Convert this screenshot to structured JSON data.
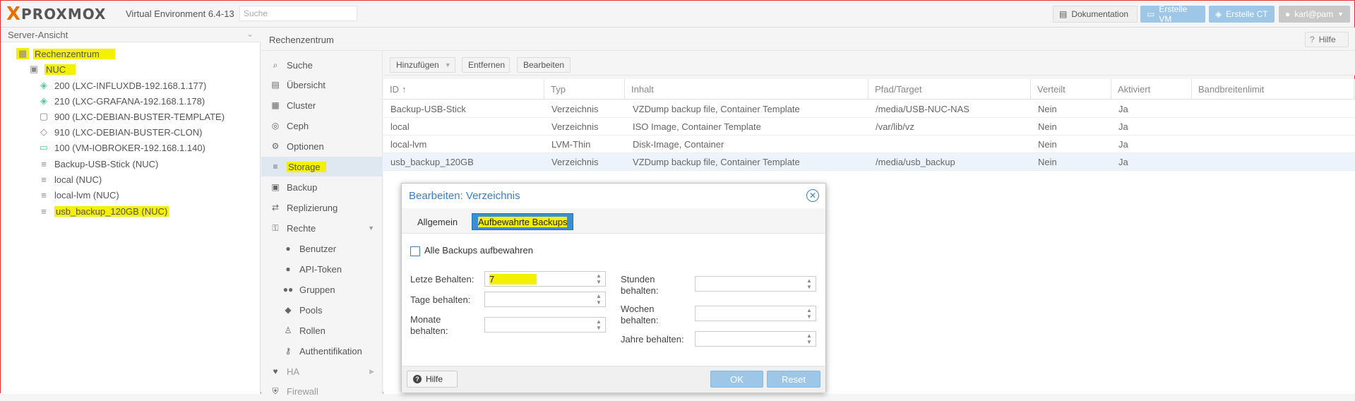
{
  "header": {
    "logo_x": "X",
    "logo_name": "PROXMOX",
    "version": "Virtual Environment 6.4-13",
    "search_placeholder": "Suche",
    "doc_label": "Dokumentation",
    "create_vm_label": "Erstelle VM",
    "create_ct_label": "Erstelle CT",
    "user_label": "karl@pam"
  },
  "left": {
    "view_label": "Server-Ansicht",
    "tree": [
      {
        "label": "Rechenzentrum"
      },
      {
        "label": "NUC"
      },
      {
        "label": "200 (LXC-INFLUXDB-192.168.1.177)"
      },
      {
        "label": "210 (LXC-GRAFANA-192.168.1.178)"
      },
      {
        "label": "900 (LXC-DEBIAN-BUSTER-TEMPLATE)"
      },
      {
        "label": "910 (LXC-DEBIAN-BUSTER-CLON)"
      },
      {
        "label": "100 (VM-IOBROKER-192.168.1.140)"
      },
      {
        "label": "Backup-USB-Stick (NUC)"
      },
      {
        "label": "local (NUC)"
      },
      {
        "label": "local-lvm (NUC)"
      },
      {
        "label": "usb_backup_120GB (NUC)"
      }
    ]
  },
  "main": {
    "title": "Rechenzentrum",
    "help_label": "Hilfe",
    "nav": [
      {
        "label": "Suche"
      },
      {
        "label": "Übersicht"
      },
      {
        "label": "Cluster"
      },
      {
        "label": "Ceph"
      },
      {
        "label": "Optionen"
      },
      {
        "label": "Storage"
      },
      {
        "label": "Backup"
      },
      {
        "label": "Replizierung"
      },
      {
        "label": "Rechte"
      },
      {
        "label": "Benutzer"
      },
      {
        "label": "API-Token"
      },
      {
        "label": "Gruppen"
      },
      {
        "label": "Pools"
      },
      {
        "label": "Rollen"
      },
      {
        "label": "Authentifikation"
      },
      {
        "label": "HA"
      },
      {
        "label": "Firewall"
      }
    ],
    "toolbar": {
      "add": "Hinzufügen",
      "remove": "Entfernen",
      "edit": "Bearbeiten"
    },
    "columns": [
      "ID",
      "Typ",
      "Inhalt",
      "Pfad/Target",
      "Verteilt",
      "Aktiviert",
      "Bandbreitenlimit"
    ],
    "rows": [
      [
        "Backup-USB-Stick",
        "Verzeichnis",
        "VZDump backup file, Container Template",
        "/media/USB-NUC-NAS",
        "Nein",
        "Ja",
        ""
      ],
      [
        "local",
        "Verzeichnis",
        "ISO Image, Container Template",
        "/var/lib/vz",
        "Nein",
        "Ja",
        ""
      ],
      [
        "local-lvm",
        "LVM-Thin",
        "Disk-Image, Container",
        "",
        "Nein",
        "Ja",
        ""
      ],
      [
        "usb_backup_120GB",
        "Verzeichnis",
        "VZDump backup file, Container Template",
        "/media/usb_backup",
        "Nein",
        "Ja",
        ""
      ]
    ]
  },
  "dialog": {
    "title": "Bearbeiten: Verzeichnis",
    "tab_general": "Allgemein",
    "tab_retention": "Aufbewahrte Backups",
    "keep_all_label": "Alle Backups aufbewahren",
    "keep_last_label": "Letze Behalten:",
    "keep_last_value": "7",
    "keep_daily_label": "Tage behalten:",
    "keep_monthly_label": "Monate behalten:",
    "keep_hourly_label": "Stunden behalten:",
    "keep_weekly_label": "Wochen behalten:",
    "keep_yearly_label": "Jahre behalten:",
    "help": "Hilfe",
    "ok": "OK",
    "reset": "Reset"
  },
  "colors": {
    "accent": "#3d7ec0",
    "highlight": "#f3f000",
    "brand": "#e57000"
  }
}
